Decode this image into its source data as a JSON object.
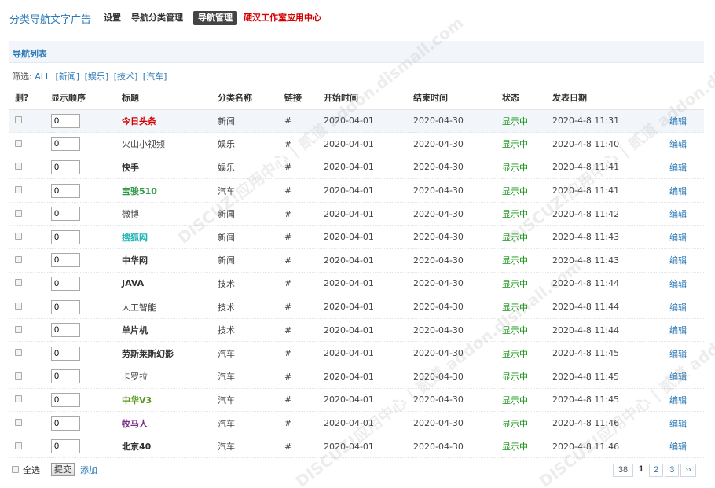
{
  "header": {
    "title": "分类导航文字广告",
    "nav": [
      {
        "label": "设置",
        "active": false,
        "red": false
      },
      {
        "label": "导航分类管理",
        "active": false,
        "red": false
      },
      {
        "label": "导航管理",
        "active": true,
        "red": false
      },
      {
        "label": "硬汉工作室应用中心",
        "active": false,
        "red": true
      }
    ]
  },
  "section_title": "导航列表",
  "filter": {
    "label": "筛选:",
    "options": [
      "ALL",
      "[新闻]",
      "[娱乐]",
      "[技术]",
      "[汽车]"
    ]
  },
  "columns": [
    "删?",
    "显示顺序",
    "标题",
    "分类名称",
    "链接",
    "开始时间",
    "结束时间",
    "状态",
    "发表日期",
    ""
  ],
  "rows": [
    {
      "order": "0",
      "title": "今日头条",
      "title_color": "#d40000",
      "bold": true,
      "category": "新闻",
      "link": "#",
      "start": "2020-04-01",
      "end": "2020-04-30",
      "status": "显示中",
      "date": "2020-4-8 11:31",
      "edit": "编辑"
    },
    {
      "order": "0",
      "title": "火山小视频",
      "title_color": "#444444",
      "bold": false,
      "category": "娱乐",
      "link": "#",
      "start": "2020-04-01",
      "end": "2020-04-30",
      "status": "显示中",
      "date": "2020-4-8 11:40",
      "edit": "编辑"
    },
    {
      "order": "0",
      "title": "快手",
      "title_color": "#333333",
      "bold": true,
      "category": "娱乐",
      "link": "#",
      "start": "2020-04-01",
      "end": "2020-04-30",
      "status": "显示中",
      "date": "2020-4-8 11:41",
      "edit": "编辑"
    },
    {
      "order": "0",
      "title": "宝骏510",
      "title_color": "#2f9a4a",
      "bold": true,
      "category": "汽车",
      "link": "#",
      "start": "2020-04-01",
      "end": "2020-04-30",
      "status": "显示中",
      "date": "2020-4-8 11:41",
      "edit": "编辑"
    },
    {
      "order": "0",
      "title": "微博",
      "title_color": "#444444",
      "bold": false,
      "category": "新闻",
      "link": "#",
      "start": "2020-04-01",
      "end": "2020-04-30",
      "status": "显示中",
      "date": "2020-4-8 11:42",
      "edit": "编辑"
    },
    {
      "order": "0",
      "title": "搜狐网",
      "title_color": "#1fb5b5",
      "bold": true,
      "category": "新闻",
      "link": "#",
      "start": "2020-04-01",
      "end": "2020-04-30",
      "status": "显示中",
      "date": "2020-4-8 11:43",
      "edit": "编辑"
    },
    {
      "order": "0",
      "title": "中华网",
      "title_color": "#333333",
      "bold": true,
      "category": "新闻",
      "link": "#",
      "start": "2020-04-01",
      "end": "2020-04-30",
      "status": "显示中",
      "date": "2020-4-8 11:43",
      "edit": "编辑"
    },
    {
      "order": "0",
      "title": "JAVA",
      "title_color": "#333333",
      "bold": true,
      "category": "技术",
      "link": "#",
      "start": "2020-04-01",
      "end": "2020-04-30",
      "status": "显示中",
      "date": "2020-4-8 11:44",
      "edit": "编辑"
    },
    {
      "order": "0",
      "title": "人工智能",
      "title_color": "#444444",
      "bold": false,
      "category": "技术",
      "link": "#",
      "start": "2020-04-01",
      "end": "2020-04-30",
      "status": "显示中",
      "date": "2020-4-8 11:44",
      "edit": "编辑"
    },
    {
      "order": "0",
      "title": "单片机",
      "title_color": "#333333",
      "bold": true,
      "category": "技术",
      "link": "#",
      "start": "2020-04-01",
      "end": "2020-04-30",
      "status": "显示中",
      "date": "2020-4-8 11:44",
      "edit": "编辑"
    },
    {
      "order": "0",
      "title": "劳斯莱斯幻影",
      "title_color": "#333333",
      "bold": true,
      "category": "汽车",
      "link": "#",
      "start": "2020-04-01",
      "end": "2020-04-30",
      "status": "显示中",
      "date": "2020-4-8 11:45",
      "edit": "编辑"
    },
    {
      "order": "0",
      "title": "卡罗拉",
      "title_color": "#444444",
      "bold": false,
      "category": "汽车",
      "link": "#",
      "start": "2020-04-01",
      "end": "2020-04-30",
      "status": "显示中",
      "date": "2020-4-8 11:45",
      "edit": "编辑"
    },
    {
      "order": "0",
      "title": "中华V3",
      "title_color": "#5a9a1e",
      "bold": true,
      "category": "汽车",
      "link": "#",
      "start": "2020-04-01",
      "end": "2020-04-30",
      "status": "显示中",
      "date": "2020-4-8 11:45",
      "edit": "编辑"
    },
    {
      "order": "0",
      "title": "牧马人",
      "title_color": "#7a2a8a",
      "bold": true,
      "category": "汽车",
      "link": "#",
      "start": "2020-04-01",
      "end": "2020-04-30",
      "status": "显示中",
      "date": "2020-4-8 11:46",
      "edit": "编辑"
    },
    {
      "order": "0",
      "title": "北京40",
      "title_color": "#333333",
      "bold": true,
      "category": "汽车",
      "link": "#",
      "start": "2020-04-01",
      "end": "2020-04-30",
      "status": "显示中",
      "date": "2020-4-8 11:46",
      "edit": "编辑"
    }
  ],
  "footer": {
    "select_all": "全选",
    "submit": "提交",
    "add": "添加"
  },
  "pager": {
    "total": "38",
    "current": "1",
    "pages": [
      "2",
      "3"
    ],
    "next": "››"
  },
  "colors": {
    "accent": "#2b79b8",
    "status_green": "#109010",
    "header_bg": "#f2f6fb"
  },
  "watermark": "DISCUZ!应用中心 | 贰道 addon.dismall.com"
}
